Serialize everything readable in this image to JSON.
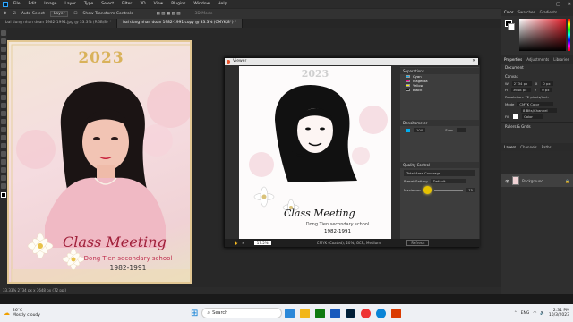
{
  "menu": {
    "items": [
      "File",
      "Edit",
      "Image",
      "Layer",
      "Type",
      "Select",
      "Filter",
      "3D",
      "View",
      "Plugins",
      "Window",
      "Help"
    ]
  },
  "options": {
    "auto_select": "Auto-Select",
    "layer": "Layer",
    "transform": "Show Transform Controls",
    "mode": "3D Mode"
  },
  "tabs": [
    {
      "label": "bai dung nhan doan 1982-1991.jpg @ 33.3% (RGB/8) *",
      "active": false
    },
    {
      "label": "bai dung nhan doan 1982-1991 copy @ 33.3% (CMYK/8*) *",
      "active": true
    }
  ],
  "poster": {
    "year": "2023",
    "title": "Class Meeting",
    "school": "Dong Tien secondary school",
    "years": "1982-1991"
  },
  "status": {
    "text": "33.33%   2734 px x 3648 px (72 ppi)"
  },
  "viewer": {
    "title": "Viewer",
    "image": {
      "year": "2023",
      "title": "Class Meeting",
      "school": "Dong Tien secondary school",
      "years": "1982-1991"
    },
    "separations": {
      "title": "Separations",
      "channels": [
        {
          "name": "Cyan",
          "color": "#00aeef"
        },
        {
          "name": "Magenta",
          "color": "#ec008c"
        },
        {
          "name": "Yellow",
          "color": "#fff200"
        },
        {
          "name": "Black",
          "color": "#111111"
        }
      ]
    },
    "densitometer": {
      "title": "Densitometer",
      "value": "100",
      "sum_label": "Sum"
    },
    "quality": {
      "title": "Quality Control",
      "coverage": "Total Area Coverage",
      "preset_label": "Preset Setting",
      "preset_value": "Default",
      "maximum_label": "Maximum",
      "maximum_value": "75"
    },
    "footer": {
      "zoom": "17.5%",
      "info": "CMYK (Coated); 20%, GCR, Medium",
      "button": "Refresh"
    }
  },
  "panels": {
    "color_tabs": [
      "Color",
      "Swatches",
      "Gradients"
    ],
    "props_tabs": [
      "Properties",
      "Adjustments",
      "Libraries"
    ],
    "document": "Document",
    "canvas_title": "Canvas",
    "w": "2734 px",
    "h": "3648 px",
    "x": "0 px",
    "y": "0 px",
    "resolution": "Resolution: 72 pixels/inch",
    "mode_label": "Mode",
    "mode_value": "CMYK Color",
    "depth_value": "8 Bits/Channel",
    "fill": "Fill",
    "fill_value": "Color",
    "rulers": "Rulers & Grids",
    "layers_tabs": [
      "Layers",
      "Channels",
      "Paths"
    ],
    "layer_name": "Background"
  },
  "taskbar": {
    "weather_temp": "26°C",
    "weather_text": "Mostly cloudy",
    "search": "Search",
    "lang": "ENG",
    "time": "2:31 PM",
    "date": "10/3/2023"
  }
}
